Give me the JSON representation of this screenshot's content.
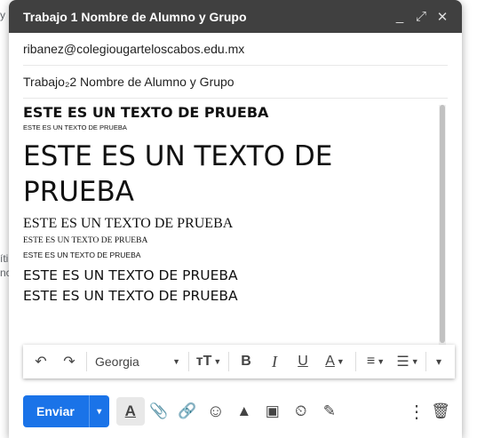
{
  "background": {
    "frag1": "y",
    "frag2": "íti",
    "frag3": "nc"
  },
  "window": {
    "title": "Trabajo 1 Nombre de Alumno y Grupo",
    "minimize_icon": "_",
    "expand_icon": "⤢",
    "close_icon": "✕"
  },
  "recipient": "ribanez@colegiougarteloscabos.edu.mx",
  "subject": "Trabajo₂2  Nombre  de Alumno y Grupo",
  "body_lines": [
    "ESTE ES UN TEXTO DE PRUEBA",
    "ESTE ES UN TEXTO DE PRUEBA",
    "ESTE ES UN TEXTO DE",
    "PRUEBA",
    "ESTE ES UN TEXTO DE PRUEBA",
    "ESTE ES UN TEXTO DE PRUEBA",
    "ESTE ES UN TEXTO DE PRUEBA",
    "ESTE ES UN TEXTO DE PRUEBA",
    "ESTE ES UN TEXTO DE PRUEBA"
  ],
  "toolbar": {
    "undo": "↶",
    "redo": "↷",
    "font": "Georgia",
    "font_size_icon": "ᴛT",
    "bold": "B",
    "italic": "I",
    "underline": "U",
    "text_color": "A",
    "align_icon": "≡",
    "list_icon": "☰",
    "more_icon": "▾"
  },
  "bottom": {
    "send_label": "Enviar",
    "send_dropdown": "▾",
    "format_icon": "A",
    "attach_icon": "📎",
    "link_icon": "🔗",
    "emoji_icon": "☺",
    "drive_icon": "▲",
    "photo_icon": "▣",
    "confidential_icon": "⏲",
    "signature_icon": "✎",
    "more_options_icon": "⋮",
    "delete_icon": "🗑"
  },
  "colors": {
    "titlebar": "#404040",
    "send": "#1a73e8"
  }
}
